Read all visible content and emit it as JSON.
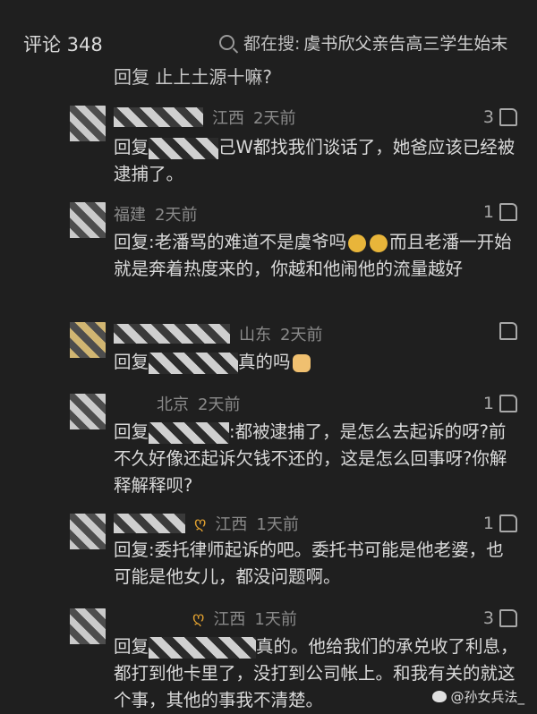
{
  "header": {
    "title": "评论 348",
    "search_prefix": "都在搜:",
    "search_hot": "虞书欣父亲告高三学生始末"
  },
  "partial_top": "回复      止上土源十嘛?",
  "comments": [
    {
      "region": "江西",
      "time": "2天前",
      "likes": "3",
      "prefix": "回复",
      "text": "己W都找我们谈话了，她爸应该已经被逮捕了。"
    },
    {
      "region": "福建",
      "time": "2天前",
      "likes": "1",
      "prefix": "回复",
      "text": ":老潘骂的难道不是虞爷吗",
      "text2": "而且老潘一开始就是奔着热度来的，你越和他闹他的流量越好"
    },
    {
      "region": "山东",
      "time": "2天前",
      "likes": "",
      "prefix": "回复",
      "text": "真的吗"
    },
    {
      "region": "北京",
      "time": "2天前",
      "likes": "1",
      "prefix": "回复",
      "text": ":都被逮捕了，是怎么去起诉的呀?前不久好像还起诉欠钱不还的，这是怎么回事呀?你解释解释呗?"
    },
    {
      "region": "江西",
      "time": "1天前",
      "likes": "1",
      "prefix": "回复",
      "text": ":委托律师起诉的吧。委托书可能是他老婆，也可能是他女儿，都没问题啊。"
    },
    {
      "region": "江西",
      "time": "1天前",
      "likes": "3",
      "prefix": "回复",
      "text": "真的。他给我们的承兑收了利息，都打到他卡里了，没打到公司帐上。和我有关的就这个事，其他的事我不清楚。"
    }
  ],
  "watermark": "@孙女兵法_"
}
